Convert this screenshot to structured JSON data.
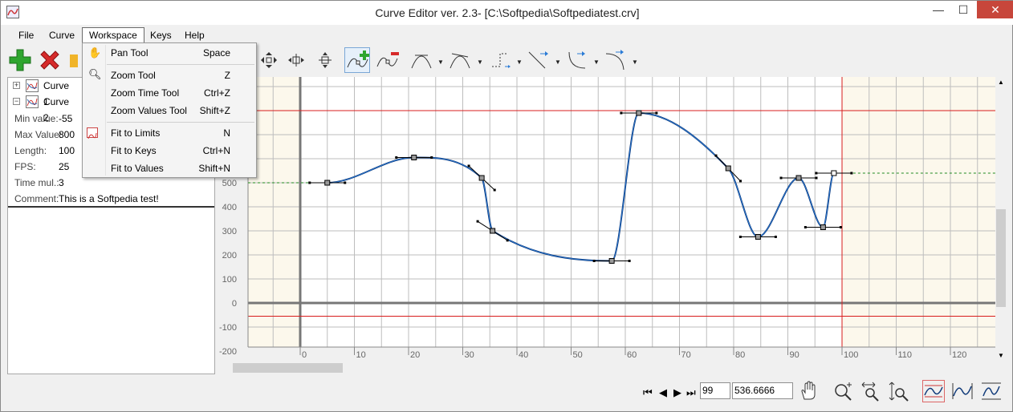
{
  "window": {
    "title": "Curve Editor ver. 2.3- [C:\\Softpedia\\Softpediatest.crv]",
    "minimize": "—",
    "maximize": "☐",
    "close": "✕"
  },
  "menu": {
    "file": "File",
    "curve": "Curve",
    "workspace": "Workspace",
    "keys": "Keys",
    "help": "Help"
  },
  "workspace_menu": {
    "items": [
      {
        "label": "Pan Tool",
        "shortcut": "Space"
      },
      {
        "label": "Zoom Tool",
        "shortcut": "Z"
      },
      {
        "label": "Zoom Time Tool",
        "shortcut": "Ctrl+Z"
      },
      {
        "label": "Zoom Values Tool",
        "shortcut": "Shift+Z"
      },
      {
        "label": "Fit to Limits",
        "shortcut": "N"
      },
      {
        "label": "Fit to Keys",
        "shortcut": "Ctrl+N"
      },
      {
        "label": "Fit to Values",
        "shortcut": "Shift+N"
      }
    ]
  },
  "tree": {
    "curves": [
      {
        "label": "Curve 1",
        "expander": "+"
      },
      {
        "label": "Curve 2",
        "expander": "−"
      }
    ]
  },
  "properties": [
    {
      "label": "Min value:",
      "value": "-55"
    },
    {
      "label": "Max Value:",
      "value": "800"
    },
    {
      "label": "Length:",
      "value": "100"
    },
    {
      "label": "FPS:",
      "value": "25"
    },
    {
      "label": "Time mul.:",
      "value": "3"
    },
    {
      "label": "Comment:",
      "value": "This is a Softpedia test!"
    }
  ],
  "chart": {
    "y_ticks": [
      "500",
      "400",
      "300",
      "200",
      "100",
      "0",
      "-100",
      "-200"
    ],
    "x_ticks": [
      "0",
      "10",
      "20",
      "30",
      "40",
      "50",
      "60",
      "70",
      "80",
      "90",
      "100",
      "110",
      "120"
    ],
    "keys": [
      {
        "t": 5,
        "v": 500
      },
      {
        "t": 21,
        "v": 605
      },
      {
        "t": 33.5,
        "v": 520
      },
      {
        "t": 35.5,
        "v": 300
      },
      {
        "t": 57.5,
        "v": 175
      },
      {
        "t": 62.5,
        "v": 790
      },
      {
        "t": 79,
        "v": 560
      },
      {
        "t": 84.5,
        "v": 275
      },
      {
        "t": 92,
        "v": 520
      },
      {
        "t": 96.5,
        "v": 315
      },
      {
        "t": 98.5,
        "v": 540
      }
    ],
    "limits": {
      "min": -55,
      "max": 800,
      "length": 100
    },
    "colors": {
      "curve": "#103a7a",
      "limit_line": "#d81c1c",
      "outside_fill": "#fcf8ec",
      "extrapolation": "#1f8a1f",
      "grid": "#bdbdbd"
    }
  },
  "status": {
    "frame": "99",
    "value": "536.6666",
    "first": "⏮",
    "prev": "◀",
    "next": "▶",
    "last": "⏭"
  }
}
